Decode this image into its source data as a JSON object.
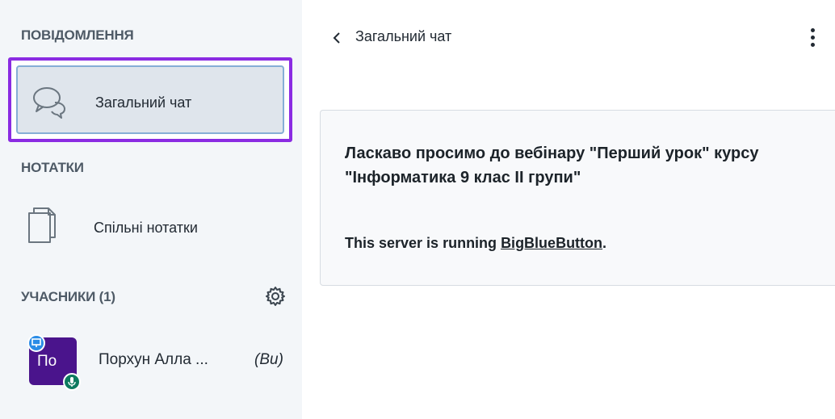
{
  "sidebar": {
    "messages_title": "ПОВІДОМЛЕННЯ",
    "public_chat_label": "Загальний чат",
    "notes_title": "НОТАТКИ",
    "shared_notes_label": "Спільні нотатки",
    "participants_title": "УЧАСНИКИ (1)",
    "user": {
      "initials": "По",
      "name": "Порхун Алла ...",
      "you_label": "(Ви)"
    }
  },
  "chat": {
    "title": "Загальний чат",
    "welcome_message": "Ласкаво просимо до вебінару \"Перший урок\" курсу \"Інформатика 9 клас ІІ групи\"",
    "server_text_prefix": "This server is running ",
    "server_link": "BigBlueButton",
    "server_text_suffix": "."
  },
  "colors": {
    "sidebar_bg": "#f3f6f9",
    "focus_outline": "#8a2be2",
    "avatar_bg": "#4a148c",
    "presenter_badge": "#2a8ce6",
    "mic_badge": "#0d7a5f"
  }
}
